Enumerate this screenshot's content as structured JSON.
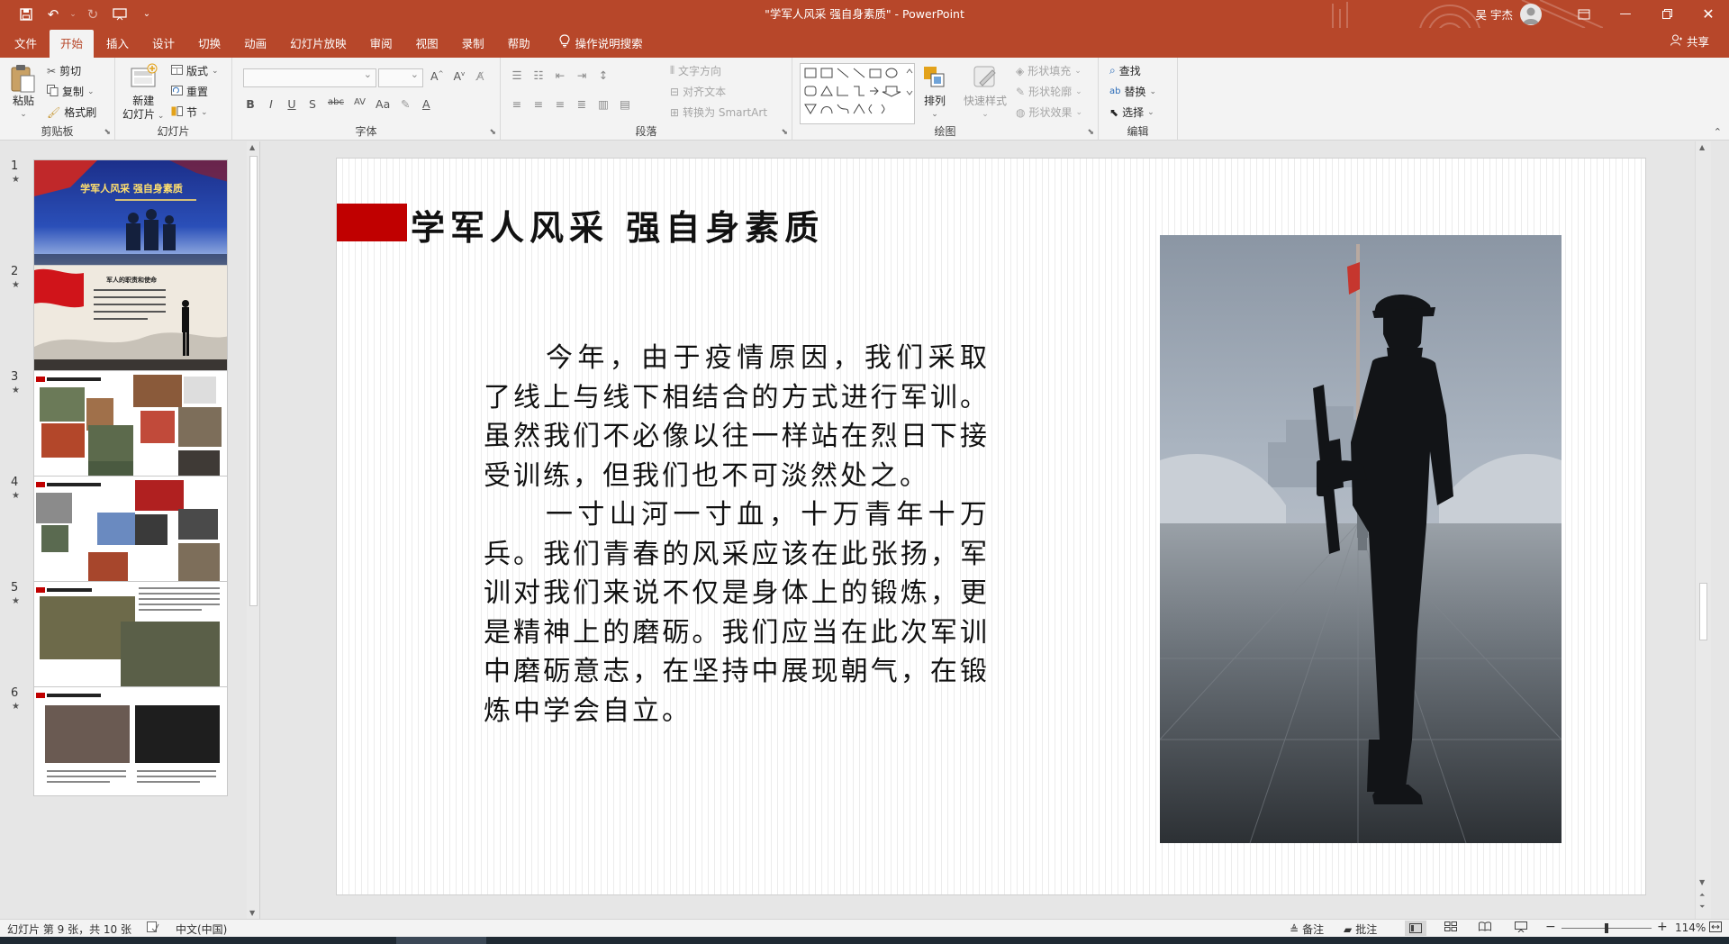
{
  "app": {
    "window_title": "\"学军人风采 强自身素质\" - PowerPoint",
    "user_name": "吴 宇杰",
    "accent_color": "#b7472a"
  },
  "tabs": [
    {
      "label": "文件"
    },
    {
      "label": "开始",
      "active": true
    },
    {
      "label": "插入"
    },
    {
      "label": "设计"
    },
    {
      "label": "切换"
    },
    {
      "label": "动画"
    },
    {
      "label": "幻灯片放映"
    },
    {
      "label": "审阅"
    },
    {
      "label": "视图"
    },
    {
      "label": "录制"
    },
    {
      "label": "帮助"
    }
  ],
  "tell_me": "操作说明搜索",
  "share_label": "共享",
  "ribbon": {
    "clipboard": {
      "paste": "粘贴",
      "cut": "剪切",
      "copy": "复制",
      "format_painter": "格式刷",
      "label": "剪贴板"
    },
    "slides": {
      "new_slide_1": "新建",
      "new_slide_2": "幻灯片",
      "layout": "版式",
      "reset": "重置",
      "section": "节",
      "label": "幻灯片"
    },
    "font": {
      "label": "字体"
    },
    "paragraph": {
      "text_direction": "文字方向",
      "align_text": "对齐文本",
      "smartart": "转换为 SmartArt",
      "label": "段落"
    },
    "drawing": {
      "arrange": "排列",
      "quick_styles": "快速样式",
      "shape_fill": "形状填充",
      "shape_outline": "形状轮廓",
      "shape_effects": "形状效果",
      "label": "绘图"
    },
    "editing": {
      "find": "查找",
      "replace": "替换",
      "select": "选择",
      "label": "编辑"
    }
  },
  "thumbnails": [
    {
      "num": "1",
      "star": "★"
    },
    {
      "num": "2",
      "star": "★"
    },
    {
      "num": "3",
      "star": "★"
    },
    {
      "num": "4",
      "star": "★"
    },
    {
      "num": "5",
      "star": "★"
    },
    {
      "num": "6",
      "star": "★"
    }
  ],
  "slide": {
    "title": "学军人风采 强自身素质",
    "paragraph_1": "今年，由于疫情原因，我们采取了线上与线下相结合的方式进行军训。虽然我们不必像以往一样站在烈日下接受训练，但我们也不可淡然处之。",
    "paragraph_2": "一寸山河一寸血，十万青年十万兵。我们青春的风采应该在此张扬，军训对我们来说不仅是身体上的锻炼，更是精神上的磨砺。我们应当在此次军训中磨砺意志，在坚持中展现朝气，在锻炼中学会自立。",
    "red_color": "#c00000"
  },
  "thumb_texts": {
    "t1_title": "学军人风采 强自身素质",
    "t2_title": "军人的职责和使命"
  },
  "status": {
    "slide_info": "幻灯片 第 9 张，共 10 张",
    "language": "中文(中国)",
    "notes": "备注",
    "comments": "批注",
    "zoom": "114%"
  }
}
